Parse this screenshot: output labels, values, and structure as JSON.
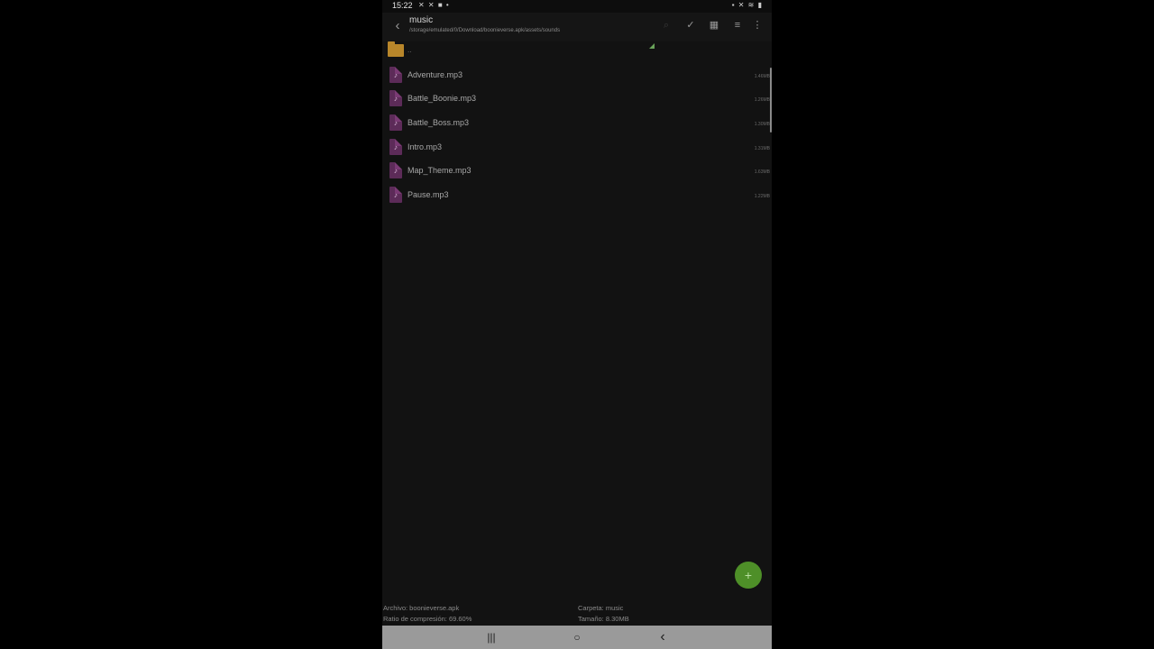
{
  "status_bar": {
    "time": "15:22",
    "left_icons": "✕ ✕ ■ •",
    "right_icons": "▪ ✕ ≋ ▮"
  },
  "toolbar": {
    "title": "music",
    "path": "/storage/emulated/0/Download/boonieverse.apk/assets/sounds",
    "back_icon": "‹",
    "icons": [
      "search-icon",
      "check-all-icon",
      "grid-view-icon",
      "sort-icon",
      "more-options-icon"
    ]
  },
  "parent_folder": {
    "label": ".."
  },
  "files": [
    {
      "name": "Adventure.mp3",
      "size": "1.46MB"
    },
    {
      "name": "Battle_Boonie.mp3",
      "size": "1.26MB"
    },
    {
      "name": "Battle_Boss.mp3",
      "size": "1.30MB"
    },
    {
      "name": "Intro.mp3",
      "size": "1.31MB"
    },
    {
      "name": "Map_Theme.mp3",
      "size": "1.63MB"
    },
    {
      "name": "Pause.mp3",
      "size": "1.22MB"
    }
  ],
  "fab": {
    "label": "+"
  },
  "footer": {
    "archive": "Archivo: boonieverse.apk",
    "compression": "Ratio de compresión: 69.60%",
    "folder": "Carpeta: music",
    "size": "Tamaño: 8.30MB"
  },
  "nav": {
    "recents": "|||",
    "home": "○",
    "back": "‹"
  }
}
